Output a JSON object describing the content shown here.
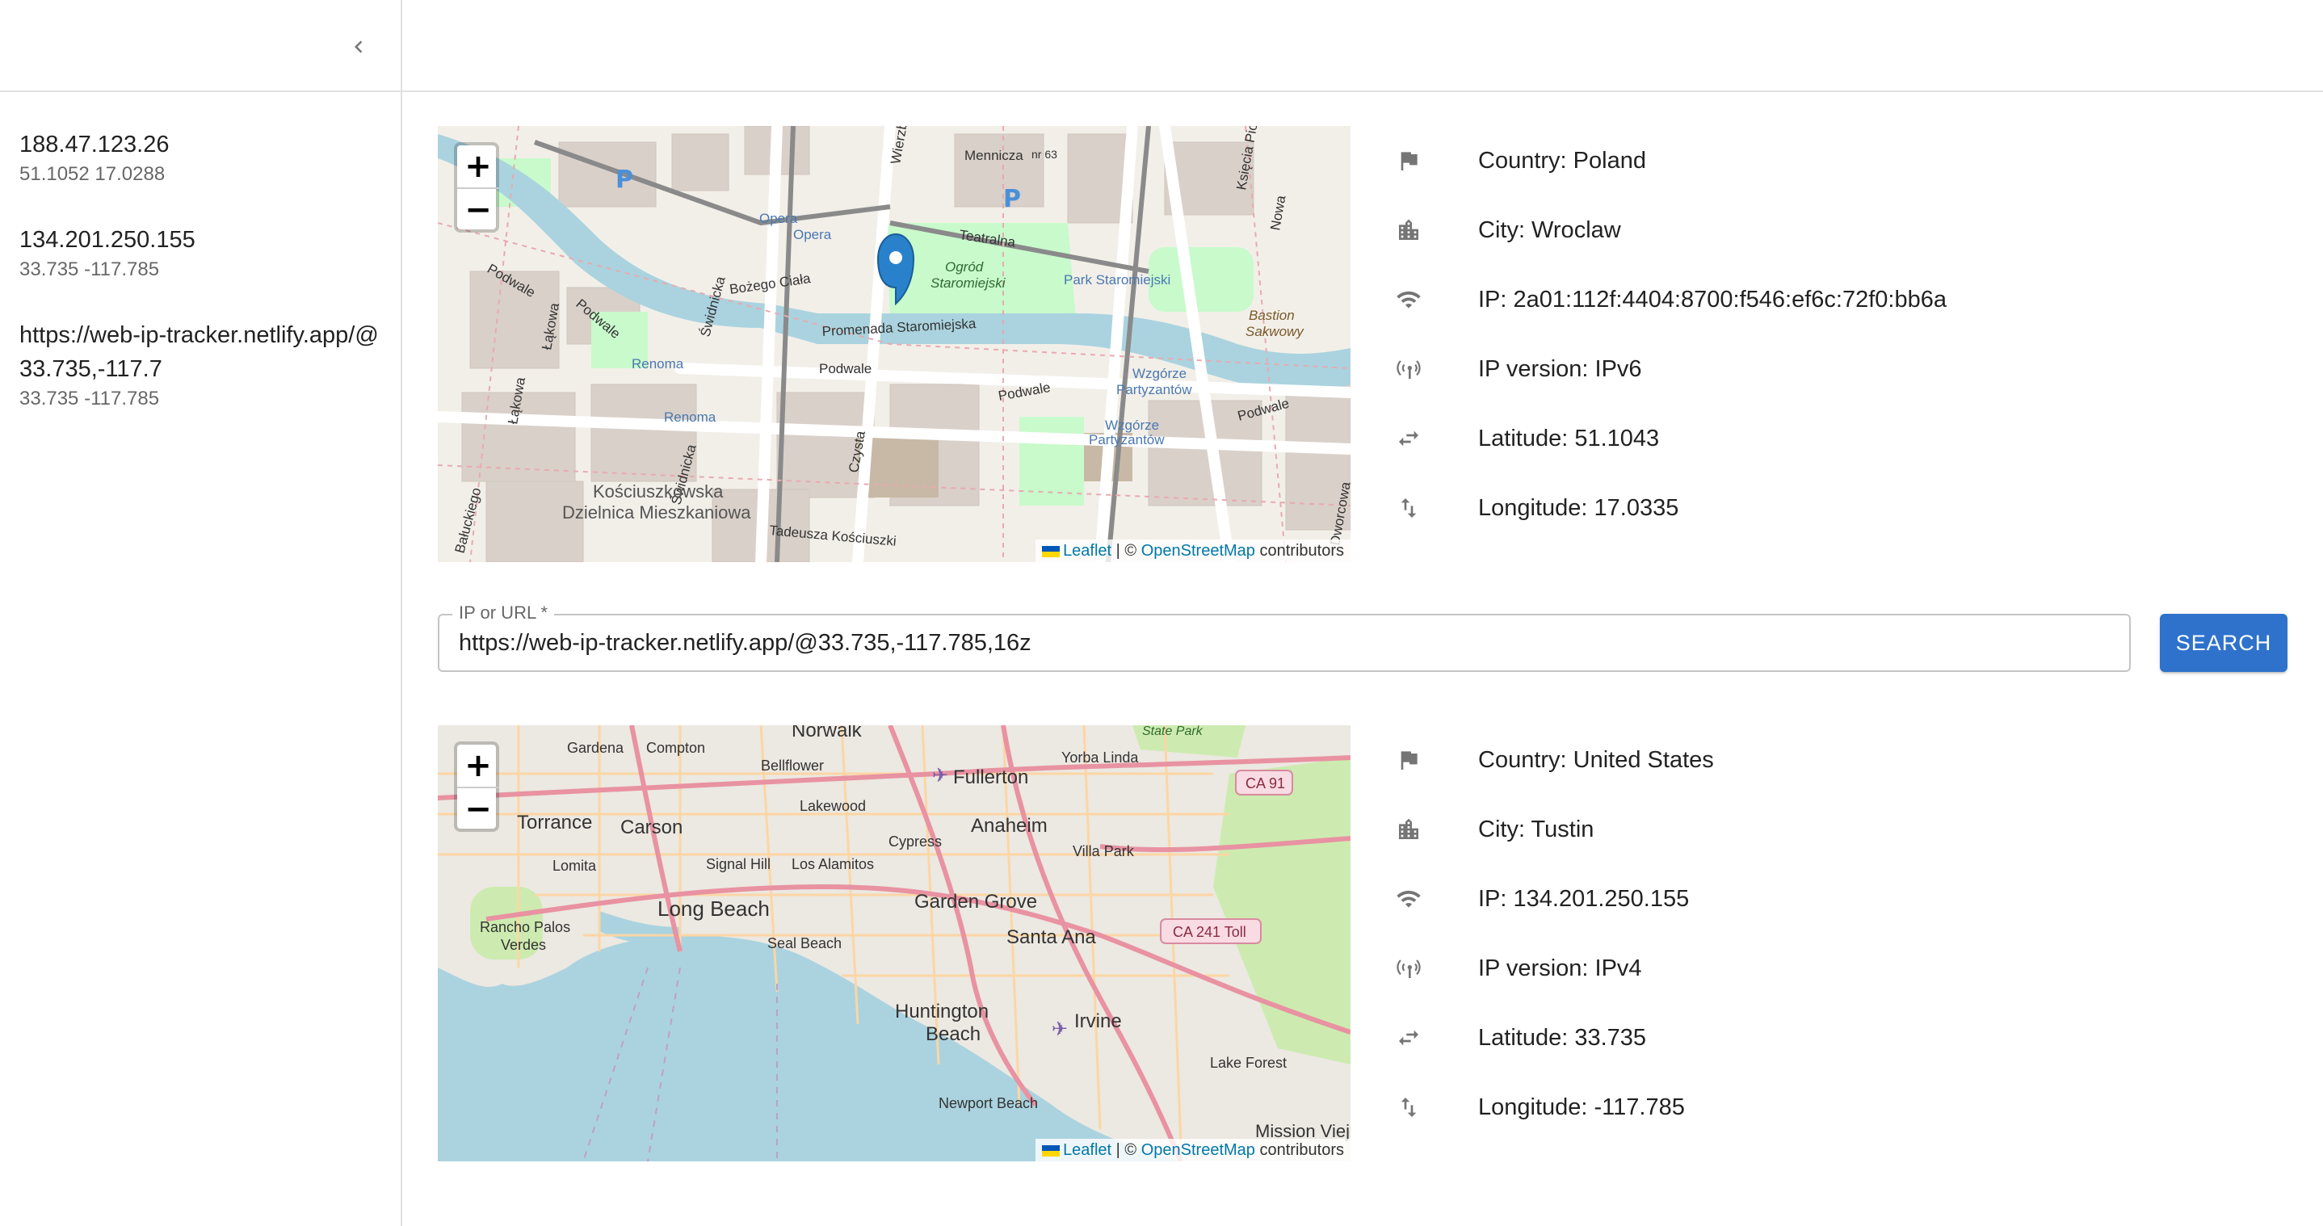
{
  "sidebar": {
    "collapse_icon": "chevron-left-icon",
    "history": [
      {
        "primary": "188.47.123.26",
        "secondary": "51.1052 17.0288"
      },
      {
        "primary": "134.201.250.155",
        "secondary": "33.735 -117.785"
      },
      {
        "primary": "https://web-ip-tracker.netlify.app/@33.735,-117.7",
        "secondary": "33.735 -117.785"
      }
    ]
  },
  "map_common": {
    "zoom_in": "+",
    "zoom_out": "−",
    "attr_leaflet": "Leaflet",
    "attr_separator": " | © ",
    "attr_osm": "OpenStreetMap",
    "attr_contributors": " contributors"
  },
  "result1": {
    "map_labels": {
      "mennicza": "Mennicza",
      "wierzbowa": "Wierzbowa",
      "ksiecia_piotra": "Księcia Piotra",
      "nowa": "Nowa",
      "opera1": "Opera",
      "opera2": "Opera",
      "teatralna": "Teatralna",
      "ogrod": "Ogród",
      "staromiejski": "Staromiejski",
      "park": "Park Staromiejski",
      "bozego_ciala": "Bożego Ciała",
      "promenada": "Promenada Staromiejska",
      "bastion": "Bastion",
      "sakwowy": "Sakwowy",
      "podwale1": "Podwale",
      "podwale2": "Podwale",
      "podwale3": "Podwale",
      "podwale4": "Podwale",
      "swidnicka1": "Świdnicka",
      "swidnicka2": "Świdnicka",
      "renoma1": "Renoma",
      "renoma2": "Renoma",
      "lakowa1": "Łąkowa",
      "lakowa2": "Łąkowa",
      "wzgorze1": "Wzgórze",
      "partyzantow1": "Partyzantów",
      "wzgorze2": "Wzgórze",
      "partyzantow2": "Partyzantów",
      "czysta": "Czysta",
      "kosciuszkowska": "Kościuszkowska",
      "dzielnica": "Dzielnica Mieszkaniowa",
      "kosciuszki": "Tadeusza Kościuszki",
      "baluckiego": "Bałuckiego",
      "worcowa": "Dworcowa",
      "nr63": "nr 63",
      "marker_icon": "location-pin-icon"
    },
    "country": "Country: Poland",
    "city": "City: Wroclaw",
    "ip": "IP: 2a01:112f:4404:8700:f546:ef6c:72f0:bb6a",
    "ip_version": "IP version: IPv6",
    "latitude": "Latitude: 51.1043",
    "longitude": "Longitude: 17.0335"
  },
  "search": {
    "label": "IP or URL *",
    "value": "https://web-ip-tracker.netlify.app/@33.735,-117.785,16z",
    "button_label": "SEARCH"
  },
  "result2": {
    "map_labels": {
      "norwalk": "Norwalk",
      "gardena": "Gardena",
      "compton": "Compton",
      "bellflower": "Bellflower",
      "fullerton": "Fullerton",
      "yorba_linda": "Yorba Linda",
      "state_park": "State Park",
      "ca91": "CA 91",
      "torrance": "Torrance",
      "carson": "Carson",
      "lakewood": "Lakewood",
      "anaheim": "Anaheim",
      "villa_park": "Villa Park",
      "lomita": "Lomita",
      "signal_hill": "Signal Hill",
      "los_alamitos": "Los Alamitos",
      "cypress": "Cypress",
      "long_beach": "Long Beach",
      "garden_grove": "Garden Grove",
      "santa_ana": "Santa Ana",
      "ca241": "CA 241 Toll",
      "rancho_palos": "Rancho Palos",
      "verdes": "Verdes",
      "seal_beach": "Seal Beach",
      "huntington": "Huntington",
      "beach": "Beach",
      "irvine": "Irvine",
      "lake_forest": "Lake Forest",
      "newport_beach": "Newport Beach",
      "mission_viejo": "Mission Viejo"
    },
    "country": "Country: United States",
    "city": "City: Tustin",
    "ip": "IP: 134.201.250.155",
    "ip_version": "IP version: IPv4",
    "latitude": "Latitude: 33.735",
    "longitude": "Longitude: -117.785"
  },
  "icons": {
    "country": "flag-icon",
    "city": "city-icon",
    "ip": "wifi-icon",
    "ip_version": "cell-tower-icon",
    "latitude": "swap-horizontal-icon",
    "longitude": "swap-vertical-icon"
  },
  "colors": {
    "primary": "#2e72cc",
    "map_water": "#aad3df",
    "map_park": "#c8facc",
    "map_land": "#f2efe9",
    "map_road_major": "#e892a2",
    "map_road_secondary": "#fcd6a4",
    "marker": "#2a81cb"
  }
}
